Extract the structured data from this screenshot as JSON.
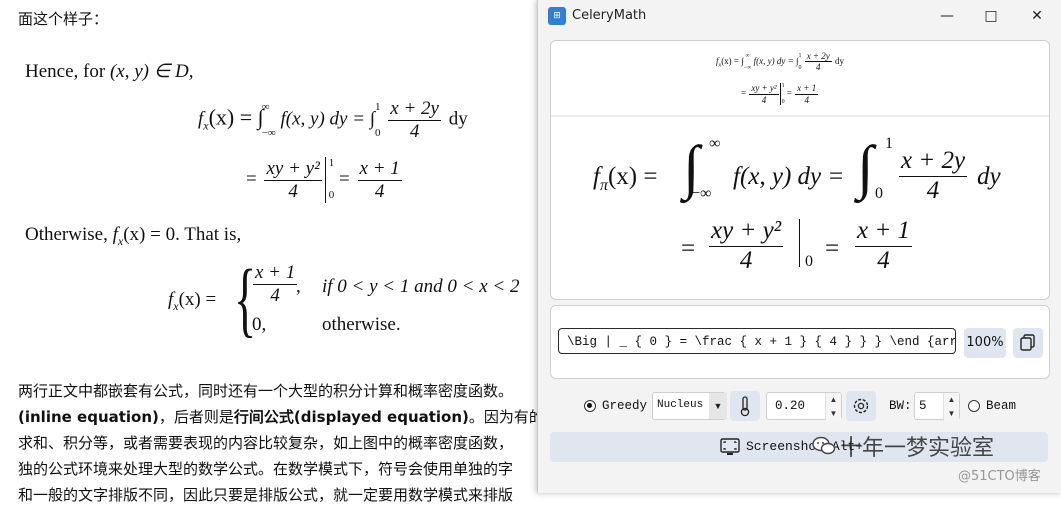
{
  "document": {
    "top_text": "面这个样子：",
    "hence": "Hence, for",
    "hence_math": "(x, y) ∈ D,",
    "eq1_lhs": "f",
    "eq1_sub": "x",
    "eq1_rest": "(x) = ∫",
    "eq1_lower": "−∞",
    "eq1_upper": "∞",
    "eq1_mid": "f(x, y) dy = ∫",
    "eq1_lower2": "0",
    "eq1_upper2": "1",
    "eq1_num": "x + 2y",
    "eq1_den": "4",
    "eq1_dy": "dy",
    "eq2_eq": "=",
    "eq2_num": "xy + y²",
    "eq2_den": "4",
    "eq2_up": "1",
    "eq2_low": "0",
    "eq2_eq2": "=",
    "eq2_num2": "x + 1",
    "eq2_den2": "4",
    "otherwise_text": "Otherwise,",
    "otherwise_math": "f",
    "otherwise_sub": "x",
    "otherwise_rest": "(x) = 0. That is,",
    "case_lhs": "f",
    "case_sub": "x",
    "case_lhs_rest": "(x) =",
    "case1_num": "x + 1",
    "case1_den": "4",
    "case1_comma": ",",
    "case1_cond": "if 0 < y < 1 and 0 < x < 2",
    "case2_val": "0,",
    "case2_cond": "otherwise.",
    "para_line1": "两行正文中都嵌套有公式，同时还有一个大型的积分计算和概率密度函数。",
    "para_line2_a": "(inline equation)",
    "para_line2_b": "，后者则是",
    "para_line2_c": "行间公式(displayed equation)",
    "para_line2_d": "。因为有的",
    "para_line3": "求和、积分等，或者需要表现的内容比较复杂，如上图中的概率密度函数，",
    "para_line4": "独的公式环境来处理大型的数学公式。在数学模式下，符号会使用单独的字",
    "para_line5": "和一般的文字排版不同，因此只要是排版公式，就一定要用数学模式来排版"
  },
  "window": {
    "title": "CeleryMath",
    "app_icon": "calculator-icon",
    "minimize": "—",
    "maximize": "□",
    "close": "✕"
  },
  "preview": {
    "thumb_line1": "f",
    "thumb_sub": "x",
    "thumb_rest": "(x) = ∫",
    "thumb_lo": "−∞",
    "thumb_hi": "∞",
    "thumb_mid": "f(x, y) dy = ∫",
    "thumb_lo2": "0",
    "thumb_hi2": "1",
    "thumb_num": "x + 2y",
    "thumb_den": "4",
    "thumb_dy": "dy",
    "thumb2_eq": "=",
    "thumb2_num": "xy + y²",
    "thumb2_den": "4",
    "thumb2_up": "1",
    "thumb2_low": "0",
    "thumb2_eq2": "=",
    "thumb2_num2": "x + 1",
    "thumb2_den2": "4",
    "big_f": "f",
    "big_sub": "π",
    "big_rest": "(x) =",
    "big_int": "∫",
    "big_lo": "−∞",
    "big_hi": "∞",
    "big_mid": "f(x, y) dy =",
    "big_int2": "∫",
    "big_lo2": "0",
    "big_hi2": "1",
    "big_num": "x + 2y",
    "big_den": "4",
    "big_dy": "dy",
    "big2_eq": "=",
    "big2_num": "xy + y²",
    "big2_den": "4",
    "big2_low": "0",
    "big2_eq2": "=",
    "big2_num2": "x + 1",
    "big2_den2": "4"
  },
  "editor": {
    "latex_value": "\\Big | _ { 0 } = \\frac { x + 1 } { 4 } } } \\end {array}",
    "zoom": "100%",
    "copy_icon": "copy-icon"
  },
  "controls": {
    "greedy_label": "Greedy",
    "greedy_selected": true,
    "model_value": "Nucleus",
    "temperature_icon": "thermometer-icon",
    "temperature": "0.20",
    "settings_icon": "gear-icon",
    "bw_label": "BW:",
    "bw_value": "5",
    "beam_label": "Beam",
    "beam_selected": false
  },
  "screenshot_button": {
    "label": "Screenshot",
    "shortcut": "+Alt+",
    "icon": "screenshot-icon"
  },
  "watermark": {
    "main": "十年一梦实验室",
    "sub": "@51CTO博客"
  }
}
